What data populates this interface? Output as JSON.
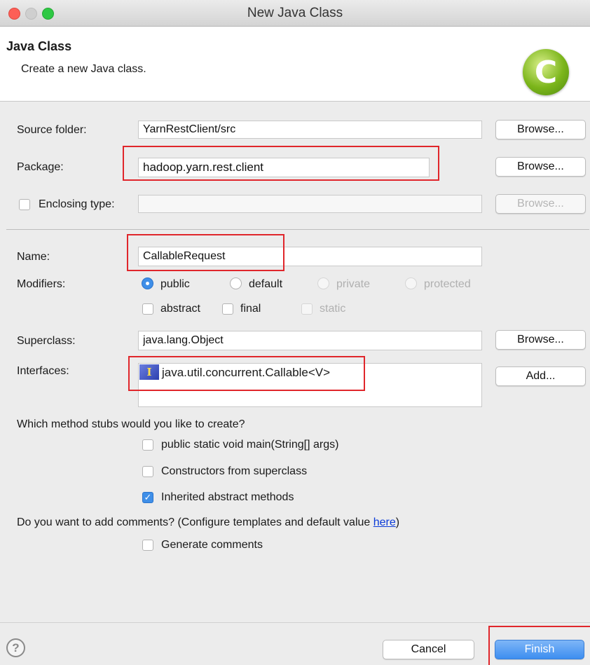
{
  "window": {
    "title": "New Java Class"
  },
  "header": {
    "title": "Java Class",
    "subtitle": "Create a new Java class.",
    "logo_letter": "C"
  },
  "form": {
    "source_folder": {
      "label": "Source folder:",
      "value": "YarnRestClient/src",
      "browse": "Browse..."
    },
    "package": {
      "label": "Package:",
      "value": "hadoop.yarn.rest.client",
      "browse": "Browse..."
    },
    "enclosing_type": {
      "label": "Enclosing type:",
      "value": "",
      "browse": "Browse...",
      "checked": false
    },
    "name": {
      "label": "Name:",
      "value": "CallableRequest"
    },
    "modifiers": {
      "label": "Modifiers:",
      "access": [
        {
          "label": "public",
          "selected": true,
          "enabled": true
        },
        {
          "label": "default",
          "selected": false,
          "enabled": true
        },
        {
          "label": "private",
          "selected": false,
          "enabled": false
        },
        {
          "label": "protected",
          "selected": false,
          "enabled": false
        }
      ],
      "flags": [
        {
          "label": "abstract",
          "checked": false,
          "enabled": true
        },
        {
          "label": "final",
          "checked": false,
          "enabled": true
        },
        {
          "label": "static",
          "checked": false,
          "enabled": false
        }
      ]
    },
    "superclass": {
      "label": "Superclass:",
      "value": "java.lang.Object",
      "browse": "Browse..."
    },
    "interfaces": {
      "label": "Interfaces:",
      "items": [
        "java.util.concurrent.Callable<V>"
      ],
      "icon_letter": "I",
      "add": "Add..."
    },
    "stubs": {
      "question": "Which method stubs would you like to create?",
      "options": [
        {
          "label": "public static void main(String[] args)",
          "checked": false
        },
        {
          "label": "Constructors from superclass",
          "checked": false
        },
        {
          "label": "Inherited abstract methods",
          "checked": true
        }
      ]
    },
    "comments": {
      "question_prefix": "Do you want to add comments? (Configure templates and default value ",
      "link": "here",
      "question_suffix": ")",
      "option": {
        "label": "Generate comments",
        "checked": false
      }
    }
  },
  "footer": {
    "help": "?",
    "cancel": "Cancel",
    "finish": "Finish"
  },
  "colors": {
    "accent": "#3f8fe8",
    "highlight": "#e0262b"
  }
}
